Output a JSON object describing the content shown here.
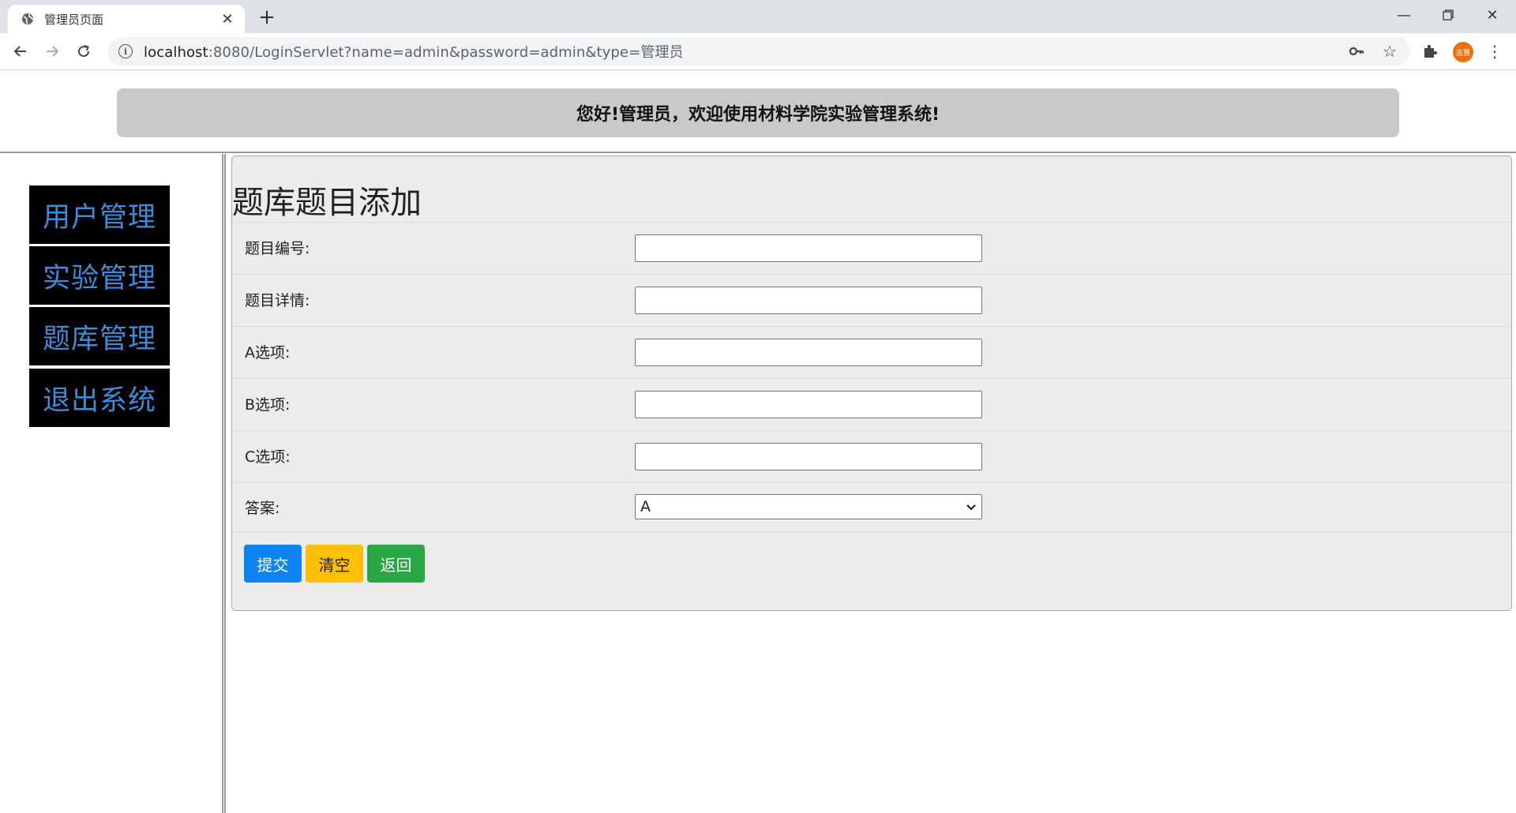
{
  "browser": {
    "tab_title": "管理员页面",
    "url_host": "localhost",
    "url_rest": ":8080/LoginServlet?name=admin&password=admin&type=管理员",
    "avatar_text": "志慧",
    "icons": [
      "globe-icon",
      "close-icon",
      "plus-icon",
      "minimize-icon",
      "restore-icon",
      "close-window-icon",
      "back-icon",
      "forward-icon",
      "reload-icon",
      "info-icon",
      "key-icon",
      "star-icon",
      "puzzle-icon",
      "kebab-menu-icon"
    ]
  },
  "banner": {
    "text": "您好!管理员，欢迎使用材料学院实验管理系统!"
  },
  "sidebar": {
    "items": [
      {
        "label": "用户管理"
      },
      {
        "label": "实验管理"
      },
      {
        "label": "题库管理"
      },
      {
        "label": "退出系统"
      }
    ],
    "item_bg": "#000000",
    "item_color": "#3d8bd9"
  },
  "form": {
    "title": "题库题目添加",
    "fields": [
      {
        "label": "题目编号:",
        "value": ""
      },
      {
        "label": "题目详情:",
        "value": ""
      },
      {
        "label": "A选项:",
        "value": ""
      },
      {
        "label": "B选项:",
        "value": ""
      },
      {
        "label": "C选项:",
        "value": ""
      }
    ],
    "answer": {
      "label": "答案:",
      "selected": "A"
    },
    "buttons": {
      "submit": {
        "label": "提交",
        "color": "#0d84f2"
      },
      "clear": {
        "label": "清空",
        "color": "#fdc004"
      },
      "back": {
        "label": "返回",
        "color": "#28a744"
      }
    }
  }
}
